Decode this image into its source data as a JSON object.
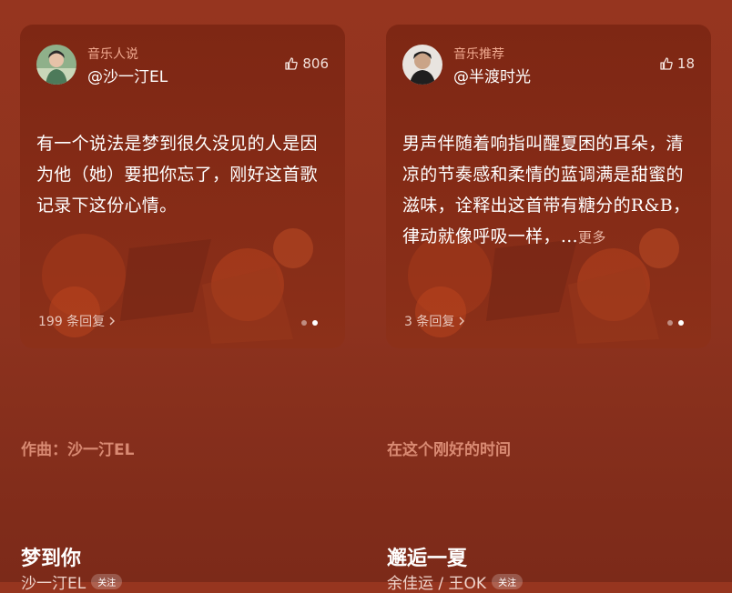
{
  "cards": [
    {
      "source": "音乐人说",
      "user": "@沙一汀EL",
      "likes": "806",
      "text": "有一个说法是梦到很久没见的人是因为他（她）要把你忘了，刚好这首歌记录下这份心情。",
      "replies": "199 条回复",
      "avatar_icon": "avatar-photo"
    },
    {
      "source": "音乐推荐",
      "user": "@半渡时光",
      "likes": "18",
      "text": "男声伴随着响指叫醒夏困的耳朵，清凉的节奏感和柔情的蓝调满是甜蜜的滋味，诠释出这首带有糖分的R&B，律动就像呼吸一样，…",
      "more": "更多",
      "replies": "3 条回复",
      "avatar_icon": "avatar-photo"
    }
  ],
  "songs": [
    {
      "info": "作曲：沙一汀EL",
      "title": "梦到你",
      "artist": "沙一汀EL",
      "follow": "关注"
    },
    {
      "info": "在这个刚好的时间",
      "title": "邂逅一夏",
      "artist": "余佳运 / 王OK",
      "follow": "关注"
    }
  ],
  "colors": {
    "background": "#96351f",
    "card": "#862c17",
    "accent_source": "#f0a98f",
    "info_text": "#d98a73"
  }
}
